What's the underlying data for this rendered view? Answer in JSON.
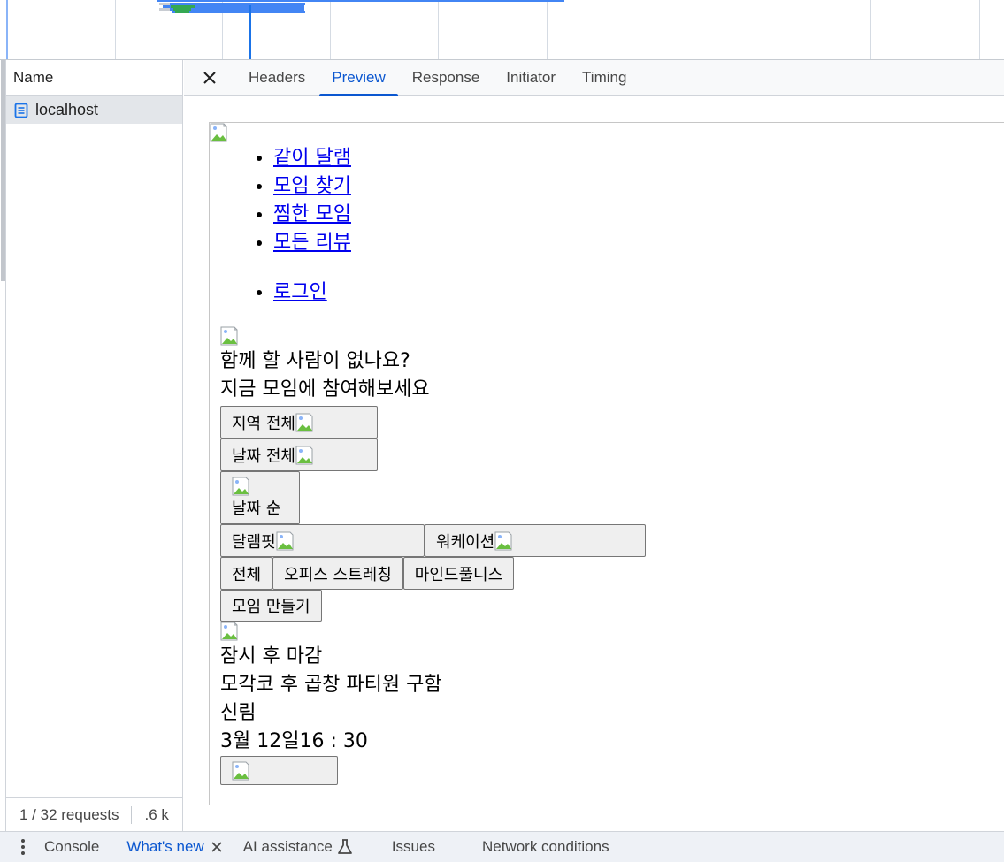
{
  "network": {
    "name_column_header": "Name",
    "request_name": "localhost",
    "footer_requests": "1 / 32 requests",
    "footer_size": ".6 k"
  },
  "detail_tabs": [
    "Headers",
    "Preview",
    "Response",
    "Initiator",
    "Timing"
  ],
  "active_detail_tab": "Preview",
  "preview": {
    "nav_links": [
      "같이 달램",
      "모임 찾기",
      "찜한 모임",
      "모든 리뷰"
    ],
    "login_link": "로그인",
    "hero_line1": "함께 할 사람이 없나요?",
    "hero_line2": "지금 모임에 참여해보세요",
    "filter_region": "지역 전체",
    "filter_date": "날짜 전체",
    "sort_label": "날짜 순",
    "category_dallaemfit": "달램핏",
    "category_workation": "워케이션",
    "sub_all": "전체",
    "sub_office_stretching": "오피스 스트레칭",
    "sub_mindfulness": "마인드풀니스",
    "create_gathering": "모임 만들기",
    "closing_soon": "잠시 후 마감",
    "gathering_title": "모각코 후 곱창 파티원 구함",
    "gathering_location": "신림",
    "gathering_date": "3월 12일",
    "gathering_time": "16 : 30"
  },
  "drawer": {
    "console": "Console",
    "whats_new": "What's new",
    "ai_assistance": "AI assistance",
    "issues": "Issues",
    "network_conditions": "Network conditions"
  },
  "colors": {
    "accent": "#0b57d0",
    "link": "#0000ee",
    "selected_row": "#e3e6ea",
    "timeline_blue": "#4285f4",
    "timeline_green": "#34a853"
  }
}
